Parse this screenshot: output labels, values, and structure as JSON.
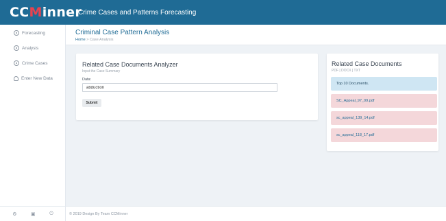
{
  "brand": {
    "prefix": "CC",
    "highlight": "M",
    "suffix": "inner"
  },
  "app_title": "Crime Cases and Patterns Forecasting",
  "sidebar": {
    "items": [
      {
        "label": "Forecasting",
        "icon": "clock-icon"
      },
      {
        "label": "Analysis",
        "icon": "clock-icon"
      },
      {
        "label": "Crime Cases",
        "icon": "clock-icon"
      },
      {
        "label": "Enter New Data",
        "icon": "user-add-icon"
      }
    ],
    "footer_icons": [
      "settings-icon",
      "keyboard-icon",
      "power-icon"
    ]
  },
  "header": {
    "title": "Criminal Case Pattern Analysis",
    "breadcrumb_home": "Home",
    "breadcrumb_sep": ">",
    "breadcrumb_current": "Case Analysis"
  },
  "analyzer": {
    "title": "Related Case Documents Analyzer",
    "subtitle": "Input the Case Summary",
    "field_label": "Data:",
    "input_value": "abduction",
    "submit_label": "Submit"
  },
  "related": {
    "title": "Related Case Documents",
    "subtitle": "PDF | DOCX | TXT",
    "notice": "Top 10 Documents.",
    "documents": [
      "SC_Appeal_97_09.pdf",
      "sc_appeal_139_14.pdf",
      "sc_appeal_118_17.pdf"
    ]
  },
  "footer": {
    "text": "© 2019 Design By Team CCMinner"
  },
  "colors": {
    "topbar": "#1f6b95",
    "brand_highlight": "#e8434f",
    "notice_bg": "#cfe6f3",
    "doc_bg": "#f4d7da"
  }
}
